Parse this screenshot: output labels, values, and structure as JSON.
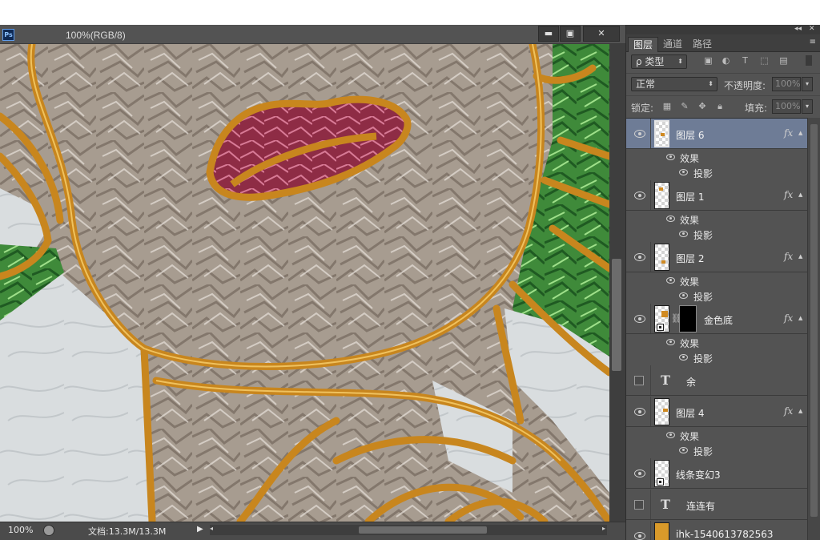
{
  "document": {
    "app_logo": "Ps",
    "title": "100%(RGB/8)",
    "window_buttons": {
      "minimize": "▬",
      "maximize": "▣",
      "close": "✕"
    },
    "zoom": "100%",
    "doc_size": "文档:13.3M/13.3M"
  },
  "panel": {
    "top_buttons": {
      "collapse": "◂◂",
      "close": "✕"
    },
    "tabs": [
      "图层",
      "通道",
      "路径"
    ],
    "active_tab": "图层",
    "menu_icon": "≡",
    "filter_kind": "ρ 类型",
    "blend_mode": "正常",
    "opacity_label": "不透明度:",
    "opacity_value": "100%",
    "lock_label": "锁定:",
    "fill_label": "填充:",
    "fill_value": "100%",
    "fx_symbol": "fx",
    "effects_label": "效果",
    "drop_shadow_label": "投影",
    "layers": [
      {
        "name": "图层 6",
        "selected": true,
        "visible": true,
        "fx": true,
        "kind": "raster"
      },
      {
        "name": "图层 1",
        "selected": false,
        "visible": true,
        "fx": true,
        "kind": "raster"
      },
      {
        "name": "图层 2",
        "selected": false,
        "visible": true,
        "fx": true,
        "kind": "raster"
      },
      {
        "name": "金色底",
        "selected": false,
        "visible": true,
        "fx": true,
        "kind": "smart-with-mask"
      },
      {
        "name": "余",
        "selected": false,
        "visible": false,
        "fx": false,
        "kind": "text"
      },
      {
        "name": "图层 4",
        "selected": false,
        "visible": true,
        "fx": true,
        "kind": "raster"
      },
      {
        "name": "线条变幻3",
        "selected": false,
        "visible": true,
        "fx": false,
        "kind": "smart"
      },
      {
        "name": "连连有",
        "selected": false,
        "visible": false,
        "fx": false,
        "kind": "text"
      },
      {
        "name": "ihk-1540613782563",
        "selected": false,
        "visible": true,
        "fx": false,
        "kind": "image"
      }
    ]
  },
  "colors": {
    "ui_bg": "#535353",
    "selected_row": "#6e7c96",
    "gold_outline": "#c8861e",
    "lips": "#8a2a42",
    "leaf_green": "#3e8a3c",
    "marble": "#d8dcdd",
    "foil": "#a89e92"
  }
}
